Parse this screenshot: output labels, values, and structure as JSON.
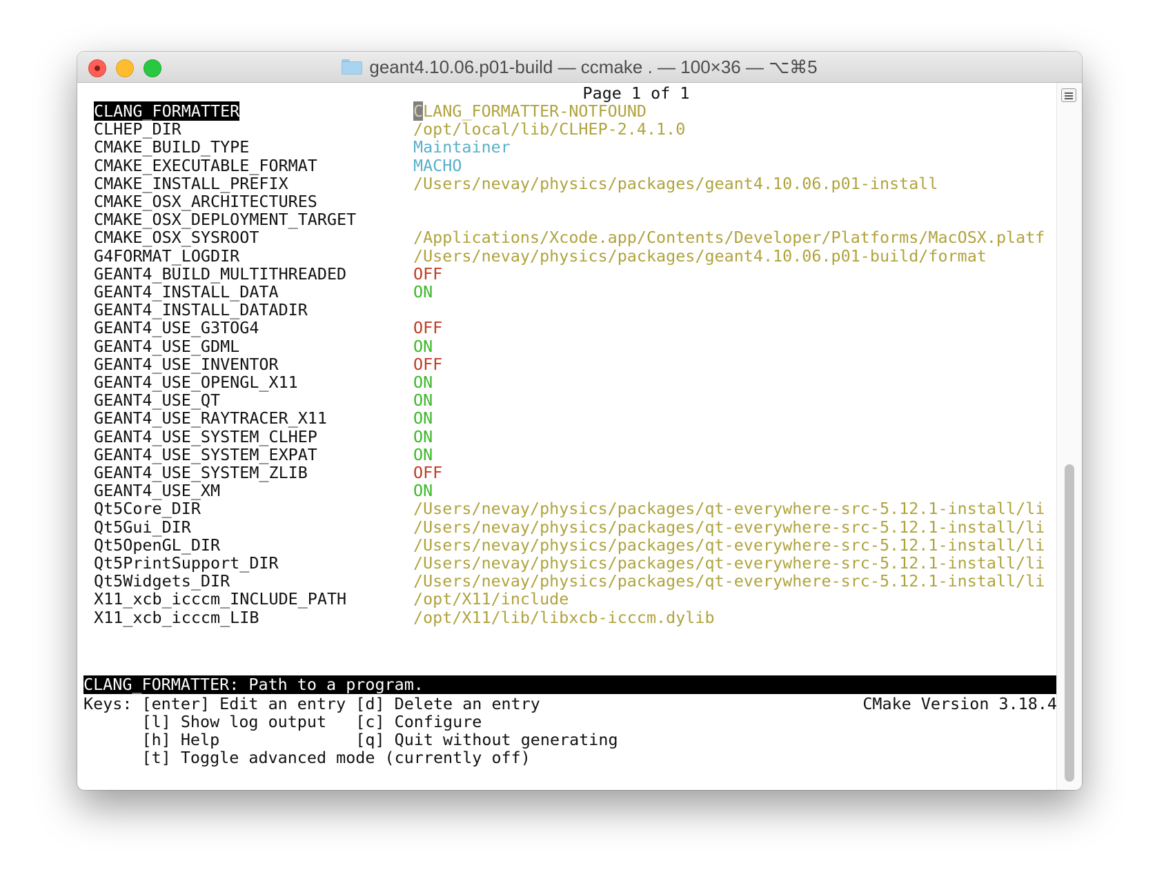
{
  "window": {
    "title": "geant4.10.06.p01-build — ccmake . — 100×36 — ⌥⌘5"
  },
  "header": {
    "page_info": "Page 1 of 1"
  },
  "entries": [
    {
      "name": "CLANG_FORMATTER",
      "value": "CLANG_FORMATTER-NOTFOUND",
      "kind": "path",
      "selected": true
    },
    {
      "name": "CLHEP_DIR",
      "value": "/opt/local/lib/CLHEP-2.4.1.0",
      "kind": "path"
    },
    {
      "name": "CMAKE_BUILD_TYPE",
      "value": "Maintainer",
      "kind": "string"
    },
    {
      "name": "CMAKE_EXECUTABLE_FORMAT",
      "value": "MACHO",
      "kind": "string"
    },
    {
      "name": "CMAKE_INSTALL_PREFIX",
      "value": "/Users/nevay/physics/packages/geant4.10.06.p01-install",
      "kind": "path"
    },
    {
      "name": "CMAKE_OSX_ARCHITECTURES",
      "value": "",
      "kind": "path"
    },
    {
      "name": "CMAKE_OSX_DEPLOYMENT_TARGET",
      "value": "",
      "kind": "path"
    },
    {
      "name": "CMAKE_OSX_SYSROOT",
      "value": "/Applications/Xcode.app/Contents/Developer/Platforms/MacOSX.platf",
      "kind": "path"
    },
    {
      "name": "G4FORMAT_LOGDIR",
      "value": "/Users/nevay/physics/packages/geant4.10.06.p01-build/format",
      "kind": "path"
    },
    {
      "name": "GEANT4_BUILD_MULTITHREADED",
      "value": "OFF",
      "kind": "off"
    },
    {
      "name": "GEANT4_INSTALL_DATA",
      "value": "ON",
      "kind": "on"
    },
    {
      "name": "GEANT4_INSTALL_DATADIR",
      "value": "",
      "kind": "path"
    },
    {
      "name": "GEANT4_USE_G3TOG4",
      "value": "OFF",
      "kind": "off"
    },
    {
      "name": "GEANT4_USE_GDML",
      "value": "ON",
      "kind": "on"
    },
    {
      "name": "GEANT4_USE_INVENTOR",
      "value": "OFF",
      "kind": "off"
    },
    {
      "name": "GEANT4_USE_OPENGL_X11",
      "value": "ON",
      "kind": "on"
    },
    {
      "name": "GEANT4_USE_QT",
      "value": "ON",
      "kind": "on"
    },
    {
      "name": "GEANT4_USE_RAYTRACER_X11",
      "value": "ON",
      "kind": "on"
    },
    {
      "name": "GEANT4_USE_SYSTEM_CLHEP",
      "value": "ON",
      "kind": "on"
    },
    {
      "name": "GEANT4_USE_SYSTEM_EXPAT",
      "value": "ON",
      "kind": "on"
    },
    {
      "name": "GEANT4_USE_SYSTEM_ZLIB",
      "value": "OFF",
      "kind": "off"
    },
    {
      "name": "GEANT4_USE_XM",
      "value": "ON",
      "kind": "on"
    },
    {
      "name": "Qt5Core_DIR",
      "value": "/Users/nevay/physics/packages/qt-everywhere-src-5.12.1-install/li",
      "kind": "path"
    },
    {
      "name": "Qt5Gui_DIR",
      "value": "/Users/nevay/physics/packages/qt-everywhere-src-5.12.1-install/li",
      "kind": "path"
    },
    {
      "name": "Qt5OpenGL_DIR",
      "value": "/Users/nevay/physics/packages/qt-everywhere-src-5.12.1-install/li",
      "kind": "path"
    },
    {
      "name": "Qt5PrintSupport_DIR",
      "value": "/Users/nevay/physics/packages/qt-everywhere-src-5.12.1-install/li",
      "kind": "path"
    },
    {
      "name": "Qt5Widgets_DIR",
      "value": "/Users/nevay/physics/packages/qt-everywhere-src-5.12.1-install/li",
      "kind": "path"
    },
    {
      "name": "X11_xcb_icccm_INCLUDE_PATH",
      "value": "/opt/X11/include",
      "kind": "path"
    },
    {
      "name": "X11_xcb_icccm_LIB",
      "value": "/opt/X11/lib/libxcb-icccm.dylib",
      "kind": "path"
    }
  ],
  "status": {
    "description": "CLANG_FORMATTER: Path to a program."
  },
  "keys": {
    "line1": "Keys: [enter] Edit an entry [d] Delete an entry",
    "line2": "      [l] Show log output   [c] Configure",
    "line3": "      [h] Help              [q] Quit without generating",
    "line4": "      [t] Toggle advanced mode (currently off)"
  },
  "version": "CMake Version 3.18.4",
  "colors": {
    "path": "#b0a33d",
    "string": "#5aafc8",
    "on": "#3eb82a",
    "off": "#c23b22"
  },
  "icons": {
    "titlebar": "folder-icon",
    "scrollbar": "page-menu-icon"
  }
}
